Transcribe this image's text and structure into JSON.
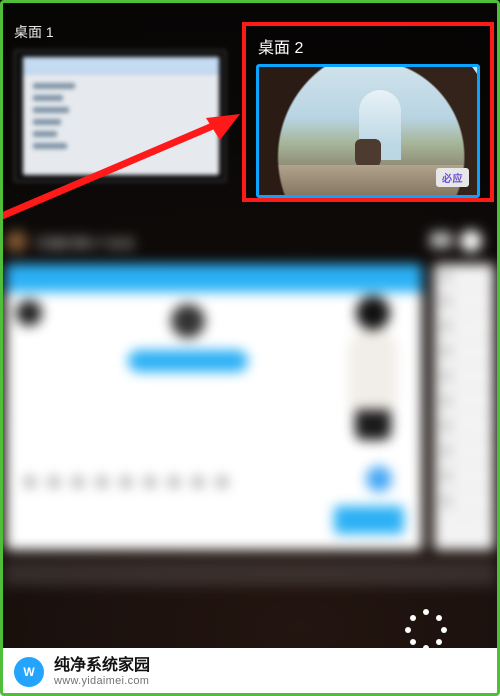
{
  "desktops": {
    "desk1_label": "桌面 1",
    "desk2_label": "桌面 2",
    "landscape_tag": "必应"
  },
  "blur_header": {
    "title_text": "花猫的第3个会话"
  },
  "watermark": {
    "logo_letter": "W",
    "site_name": "纯净系统家园",
    "site_url": "www.yidaimei.com"
  }
}
